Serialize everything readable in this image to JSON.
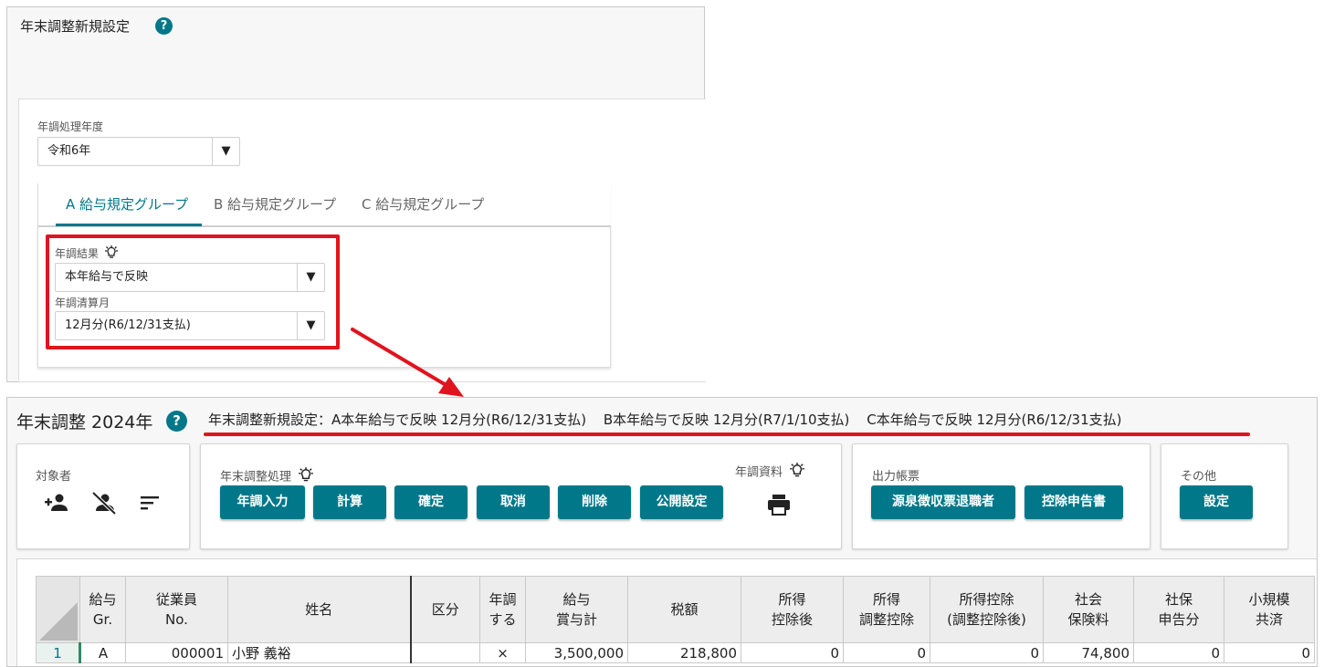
{
  "top_panel": {
    "title": "年末調整新規設定",
    "help_icon": "?",
    "year_label": "年調処理年度",
    "year_value": "令和6年",
    "dropdown_arrow": "▼",
    "tabs": [
      {
        "label": "A 給与規定グループ",
        "active": true
      },
      {
        "label": "B 給与規定グループ",
        "active": false
      },
      {
        "label": "C 給与規定グループ",
        "active": false
      }
    ],
    "result_label": "年調結果",
    "result_value": "本年給与で反映",
    "month_label": "年調清算月",
    "month_value": "12月分(R6/12/31支払)"
  },
  "bottom_panel": {
    "title": "年末調整 2024年",
    "info": [
      "年末調整新規設定：A本年給与で反映 12月分(R6/12/31支払)",
      "B本年給与で反映 12月分(R7/1/10支払)",
      "C本年給与で反映 12月分(R6/12/31支払)"
    ],
    "groups": {
      "target": {
        "label": "対象者",
        "icons": [
          "add-person-icon",
          "remove-person-icon",
          "sort-icon"
        ]
      },
      "process": {
        "label": "年末調整処理",
        "buttons": [
          "年調入力",
          "計算",
          "確定",
          "取消",
          "削除",
          "公開設定"
        ]
      },
      "material": {
        "label": "年調資料",
        "icon": "print-icon"
      },
      "output": {
        "label": "出力帳票",
        "buttons": [
          "源泉徴収票退職者",
          "控除申告書"
        ]
      },
      "other": {
        "label": "その他",
        "buttons": [
          "設定"
        ]
      }
    },
    "table": {
      "headers": [
        [
          "給与",
          "Gr."
        ],
        [
          "従業員",
          "No."
        ],
        [
          "姓名"
        ],
        [
          "区分"
        ],
        [
          "年調",
          "する"
        ],
        [
          "給与",
          "賞与計"
        ],
        [
          "税額"
        ],
        [
          "所得",
          "控除後"
        ],
        [
          "所得",
          "調整控除"
        ],
        [
          "所得控除",
          "(調整控除後)"
        ],
        [
          "社会",
          "保険料"
        ],
        [
          "社保",
          "申告分"
        ],
        [
          "小規模",
          "共済"
        ]
      ],
      "rows": [
        {
          "row_no": "1",
          "cells": [
            "A",
            "000001",
            "小野 義裕",
            "",
            "×",
            "3,500,000",
            "218,800",
            "0",
            "0",
            "0",
            "74,800",
            "0",
            "0"
          ]
        }
      ]
    }
  },
  "colors": {
    "accent": "#00788a",
    "highlight": "#e0141e"
  }
}
